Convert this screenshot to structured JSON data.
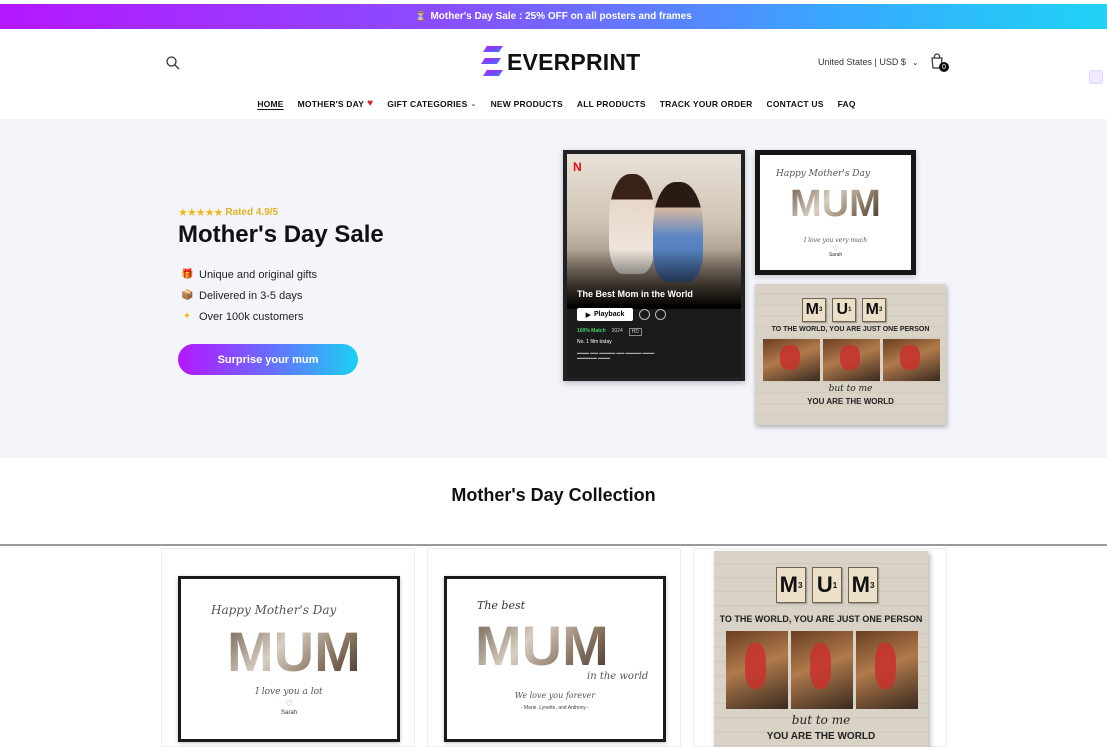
{
  "announcement": {
    "icon": "hourglass-icon",
    "text": "Mother's Day Sale : 25% OFF on all posters and frames"
  },
  "header": {
    "logo_text": "EVERPRINT",
    "currency": "United States | USD $",
    "cart_count": "0"
  },
  "nav": [
    {
      "label": "HOME"
    },
    {
      "label": "MOTHER'S DAY"
    },
    {
      "label": "GIFT CATEGORIES"
    },
    {
      "label": "NEW PRODUCTS"
    },
    {
      "label": "ALL PRODUCTS"
    },
    {
      "label": "TRACK YOUR ORDER"
    },
    {
      "label": "CONTACT US"
    },
    {
      "label": "FAQ"
    }
  ],
  "hero": {
    "rating_text": "Rated 4.9/5",
    "rating_value": 4.9,
    "title": "Mother's Day Sale",
    "benefits": [
      {
        "icon": "gift-icon",
        "text": "Unique and original gifts"
      },
      {
        "icon": "box-icon",
        "text": "Delivered in 3-5 days"
      },
      {
        "icon": "sparkle-icon",
        "text": "Over 100k customers"
      }
    ],
    "cta": "Surprise your mum",
    "netflix_poster": {
      "brand": "N",
      "title": "The Best Mom in the World",
      "play": "Playback",
      "match": "100% Match",
      "year": "2024",
      "quality": "HD",
      "top": "No. 1 film today"
    },
    "mum_poster": {
      "script": "Happy Mother's Day",
      "word": "MUM",
      "line": "I love you very much",
      "name": "Sarah"
    },
    "wood_canvas": {
      "tiles": [
        "M",
        "U",
        "M"
      ],
      "subs": [
        "3",
        "1",
        "3"
      ],
      "line1": "TO THE WORLD, YOU ARE JUST ONE PERSON",
      "script": "but to me",
      "line2": "YOU ARE THE WORLD"
    }
  },
  "collection": {
    "title": "Mother's Day Collection",
    "cards": [
      {
        "script": "Happy Mother's Day",
        "word": "MUM",
        "line": "I love you a lot",
        "name": "Sarah"
      },
      {
        "script": "The best",
        "word": "MUM",
        "line": "in the world",
        "sub": "We love you forever",
        "names": "- Marie, Lynette, and Anthony -"
      },
      {
        "tiles": [
          "M",
          "U",
          "M"
        ],
        "subs": [
          "3",
          "1",
          "3"
        ],
        "line1": "TO THE WORLD, YOU ARE JUST ONE PERSON",
        "script": "but to me",
        "line2": "YOU ARE THE WORLD"
      }
    ]
  },
  "colors": {
    "gradient_start": "#b517ff",
    "gradient_end": "#1fd3f5",
    "hero_bg": "#f4f5fb",
    "star": "#f2b81b"
  }
}
